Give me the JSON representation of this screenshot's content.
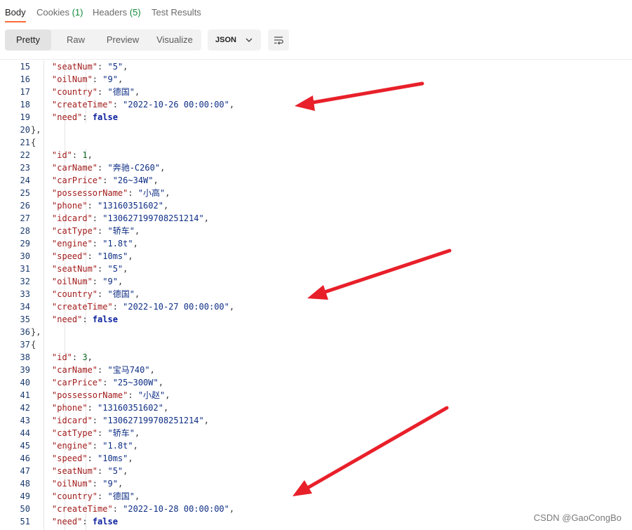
{
  "tabs": [
    {
      "label": "Body",
      "count": ""
    },
    {
      "label": "Cookies",
      "count": "(1)"
    },
    {
      "label": "Headers",
      "count": "(5)"
    },
    {
      "label": "Test Results",
      "count": ""
    }
  ],
  "view_modes": [
    "Pretty",
    "Raw",
    "Preview",
    "Visualize"
  ],
  "active_view": "Pretty",
  "format_select": {
    "value": "JSON"
  },
  "code_lines": [
    {
      "num": "15",
      "indent": 2,
      "key": "seatNum",
      "str": "5",
      "comma": true
    },
    {
      "num": "16",
      "indent": 2,
      "key": "oilNum",
      "str": "9",
      "comma": true
    },
    {
      "num": "17",
      "indent": 2,
      "key": "country",
      "str": "德国",
      "comma": true
    },
    {
      "num": "18",
      "indent": 2,
      "key": "createTime",
      "str": "2022-10-26 00:00:00",
      "comma": true
    },
    {
      "num": "19",
      "indent": 2,
      "key": "need",
      "lit": "false"
    },
    {
      "num": "20",
      "indent": 1,
      "punct": "},"
    },
    {
      "num": "21",
      "indent": 1,
      "punct": "{"
    },
    {
      "num": "22",
      "indent": 2,
      "key": "id",
      "numval": "1",
      "comma": true
    },
    {
      "num": "23",
      "indent": 2,
      "key": "carName",
      "str": "奔驰-C260",
      "comma": true
    },
    {
      "num": "24",
      "indent": 2,
      "key": "carPrice",
      "str": "26~34W",
      "comma": true
    },
    {
      "num": "25",
      "indent": 2,
      "key": "possessorName",
      "str": "小高",
      "comma": true
    },
    {
      "num": "26",
      "indent": 2,
      "key": "phone",
      "str": "13160351602",
      "comma": true
    },
    {
      "num": "27",
      "indent": 2,
      "key": "idcard",
      "str": "130627199708251214",
      "comma": true
    },
    {
      "num": "28",
      "indent": 2,
      "key": "catType",
      "str": "轿车",
      "comma": true
    },
    {
      "num": "29",
      "indent": 2,
      "key": "engine",
      "str": "1.8t",
      "comma": true
    },
    {
      "num": "30",
      "indent": 2,
      "key": "speed",
      "str": "10ms",
      "comma": true
    },
    {
      "num": "31",
      "indent": 2,
      "key": "seatNum",
      "str": "5",
      "comma": true
    },
    {
      "num": "32",
      "indent": 2,
      "key": "oilNum",
      "str": "9",
      "comma": true
    },
    {
      "num": "33",
      "indent": 2,
      "key": "country",
      "str": "德国",
      "comma": true
    },
    {
      "num": "34",
      "indent": 2,
      "key": "createTime",
      "str": "2022-10-27 00:00:00",
      "comma": true
    },
    {
      "num": "35",
      "indent": 2,
      "key": "need",
      "lit": "false"
    },
    {
      "num": "36",
      "indent": 1,
      "punct": "},"
    },
    {
      "num": "37",
      "indent": 1,
      "punct": "{"
    },
    {
      "num": "38",
      "indent": 2,
      "key": "id",
      "numval": "3",
      "comma": true
    },
    {
      "num": "39",
      "indent": 2,
      "key": "carName",
      "str": "宝马740",
      "comma": true
    },
    {
      "num": "40",
      "indent": 2,
      "key": "carPrice",
      "str": "25~300W",
      "comma": true
    },
    {
      "num": "41",
      "indent": 2,
      "key": "possessorName",
      "str": "小赵",
      "comma": true
    },
    {
      "num": "42",
      "indent": 2,
      "key": "phone",
      "str": "13160351602",
      "comma": true
    },
    {
      "num": "43",
      "indent": 2,
      "key": "idcard",
      "str": "130627199708251214",
      "comma": true
    },
    {
      "num": "44",
      "indent": 2,
      "key": "catType",
      "str": "轿车",
      "comma": true
    },
    {
      "num": "45",
      "indent": 2,
      "key": "engine",
      "str": "1.8t",
      "comma": true
    },
    {
      "num": "46",
      "indent": 2,
      "key": "speed",
      "str": "10ms",
      "comma": true
    },
    {
      "num": "47",
      "indent": 2,
      "key": "seatNum",
      "str": "5",
      "comma": true
    },
    {
      "num": "48",
      "indent": 2,
      "key": "oilNum",
      "str": "9",
      "comma": true
    },
    {
      "num": "49",
      "indent": 2,
      "key": "country",
      "str": "德国",
      "comma": true
    },
    {
      "num": "50",
      "indent": 2,
      "key": "createTime",
      "str": "2022-10-28 00:00:00",
      "comma": true
    },
    {
      "num": "51",
      "indent": 2,
      "key": "need",
      "lit": "false"
    }
  ],
  "colors": {
    "accent": "#ff6c37",
    "annotation_arrow": "#e8202a",
    "json_key": "#a21b1b",
    "json_string": "#0f2f86",
    "json_number": "#0c6b21"
  },
  "icons": {
    "format_chevron": "chevron-down-icon",
    "wrap": "text-wrap-icon"
  },
  "watermark": "CSDN @GaoCongBo"
}
